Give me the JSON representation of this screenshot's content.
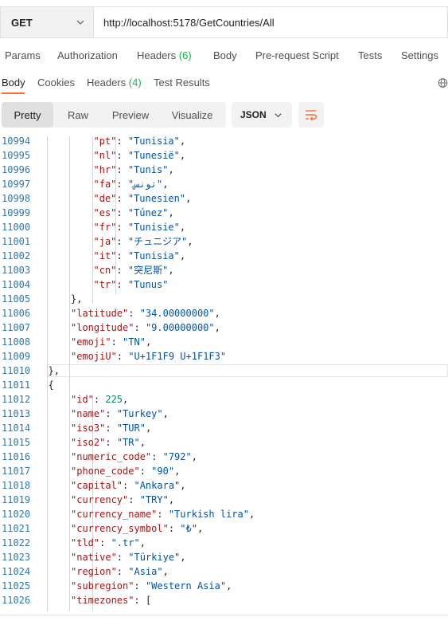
{
  "request": {
    "method": "GET",
    "url": "http://localhost:5178/GetCountries/All",
    "tabs": [
      {
        "label": "Params"
      },
      {
        "label": "Authorization"
      },
      {
        "label": "Headers",
        "count": "(6)"
      },
      {
        "label": "Body"
      },
      {
        "label": "Pre-request Script"
      },
      {
        "label": "Tests"
      },
      {
        "label": "Settings"
      }
    ]
  },
  "response": {
    "tabs": [
      {
        "label": "Body"
      },
      {
        "label": "Cookies"
      },
      {
        "label": "Headers",
        "count": "(4)"
      },
      {
        "label": "Test Results"
      }
    ],
    "formats": [
      "Pretty",
      "Raw",
      "Preview",
      "Visualize"
    ],
    "selected_format": "Pretty",
    "language": "JSON"
  },
  "colors": {
    "accent": "#ff6c37",
    "count_green": "#0cbb52",
    "key": "#a31515",
    "string": "#0451a5",
    "number": "#098658",
    "line_number": "#3575a6"
  },
  "icons": [
    "chevron-down-icon",
    "globe-icon",
    "wrap-lines-icon"
  ],
  "code_lines": [
    {
      "n": "10994",
      "indent": 3,
      "key": "pt",
      "val": "Tunisia",
      "type": "str",
      "comma": true
    },
    {
      "n": "10995",
      "indent": 3,
      "key": "nl",
      "val": "Tunesië",
      "type": "str",
      "comma": true
    },
    {
      "n": "10996",
      "indent": 3,
      "key": "hr",
      "val": "Tunis",
      "type": "str",
      "comma": true
    },
    {
      "n": "10997",
      "indent": 3,
      "key": "fa",
      "val": "تونس",
      "type": "str",
      "comma": true
    },
    {
      "n": "10998",
      "indent": 3,
      "key": "de",
      "val": "Tunesien",
      "type": "str",
      "comma": true
    },
    {
      "n": "10999",
      "indent": 3,
      "key": "es",
      "val": "Túnez",
      "type": "str",
      "comma": true
    },
    {
      "n": "11000",
      "indent": 3,
      "key": "fr",
      "val": "Tunisie",
      "type": "str",
      "comma": true
    },
    {
      "n": "11001",
      "indent": 3,
      "key": "ja",
      "val": "チュニジア",
      "type": "str",
      "comma": true
    },
    {
      "n": "11002",
      "indent": 3,
      "key": "it",
      "val": "Tunisia",
      "type": "str",
      "comma": true
    },
    {
      "n": "11003",
      "indent": 3,
      "key": "cn",
      "val": "突尼斯",
      "type": "str",
      "comma": true
    },
    {
      "n": "11004",
      "indent": 3,
      "key": "tr",
      "val": "Tunus",
      "type": "str",
      "comma": false
    },
    {
      "n": "11005",
      "indent": 2,
      "raw": "},"
    },
    {
      "n": "11006",
      "indent": 2,
      "key": "latitude",
      "val": "34.00000000",
      "type": "str",
      "comma": true
    },
    {
      "n": "11007",
      "indent": 2,
      "key": "longitude",
      "val": "9.00000000",
      "type": "str",
      "comma": true
    },
    {
      "n": "11008",
      "indent": 2,
      "key": "emoji",
      "val": "TN",
      "type": "str",
      "comma": true
    },
    {
      "n": "11009",
      "indent": 2,
      "key": "emojiU",
      "val": "U+1F1F9 U+1F1F3",
      "type": "str",
      "comma": false
    },
    {
      "n": "11010",
      "indent": 1,
      "raw": "},"
    },
    {
      "n": "11011",
      "indent": 1,
      "raw": "{"
    },
    {
      "n": "11012",
      "indent": 2,
      "key": "id",
      "val": "225",
      "type": "num",
      "comma": true
    },
    {
      "n": "11013",
      "indent": 2,
      "key": "name",
      "val": "Turkey",
      "type": "str",
      "comma": true
    },
    {
      "n": "11014",
      "indent": 2,
      "key": "iso3",
      "val": "TUR",
      "type": "str",
      "comma": true
    },
    {
      "n": "11015",
      "indent": 2,
      "key": "iso2",
      "val": "TR",
      "type": "str",
      "comma": true
    },
    {
      "n": "11016",
      "indent": 2,
      "key": "numeric_code",
      "val": "792",
      "type": "str",
      "comma": true
    },
    {
      "n": "11017",
      "indent": 2,
      "key": "phone_code",
      "val": "90",
      "type": "str",
      "comma": true
    },
    {
      "n": "11018",
      "indent": 2,
      "key": "capital",
      "val": "Ankara",
      "type": "str",
      "comma": true
    },
    {
      "n": "11019",
      "indent": 2,
      "key": "currency",
      "val": "TRY",
      "type": "str",
      "comma": true
    },
    {
      "n": "11020",
      "indent": 2,
      "key": "currency_name",
      "val": "Turkish lira",
      "type": "str",
      "comma": true
    },
    {
      "n": "11021",
      "indent": 2,
      "key": "currency_symbol",
      "val": "₺",
      "type": "str",
      "comma": true
    },
    {
      "n": "11022",
      "indent": 2,
      "key": "tld",
      "val": ".tr",
      "type": "str",
      "comma": true
    },
    {
      "n": "11023",
      "indent": 2,
      "key": "native",
      "val": "Türkiye",
      "type": "str",
      "comma": true
    },
    {
      "n": "11024",
      "indent": 2,
      "key": "region",
      "val": "Asia",
      "type": "str",
      "comma": true
    },
    {
      "n": "11025",
      "indent": 2,
      "key": "subregion",
      "val": "Western Asia",
      "type": "str",
      "comma": true
    },
    {
      "n": "11026",
      "indent": 2,
      "key": "timezones",
      "raw_after": "[",
      "type": "open"
    }
  ]
}
